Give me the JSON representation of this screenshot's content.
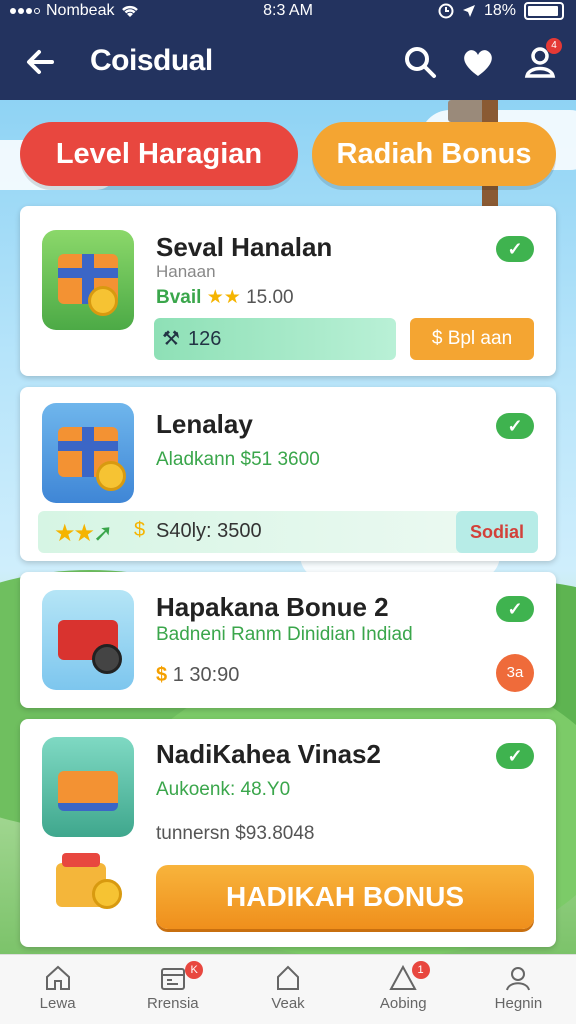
{
  "status_bar": {
    "carrier": "Nombeak",
    "time": "8:3 AM",
    "battery": "18%"
  },
  "header": {
    "title": "Coisdual",
    "notification_badge": "4"
  },
  "tabs": {
    "left": "Level Haragian",
    "right": "Radiah Bonus"
  },
  "cards": [
    {
      "title": "Seval Hanalan",
      "subtitle": "Hanaan",
      "rating_label": "Bvail",
      "rating_value": "15.00",
      "progress_value": "126",
      "action_label": "$ Bpl aan"
    },
    {
      "title": "Lenalay",
      "subtitle": "Aladkann $51 3600",
      "strip_text": "S40ly: 3500",
      "action_label": "Sodial"
    },
    {
      "title": "Hapakana Bonue 2",
      "subtitle": "Badneni Ranm Dinidian Indiad",
      "amount": "1 30:90",
      "badge": "3a"
    },
    {
      "title": "NadiKahea Vinas2",
      "subtitle": "Aukoenk: 48.Y0",
      "price_line": "tunnersn $93.8048",
      "cta_label": "HADIKAH BONUS"
    }
  ],
  "bottom_nav": [
    {
      "label": "Lewa",
      "icon": "home-icon",
      "badge": ""
    },
    {
      "label": "Rrensia",
      "icon": "calendar-icon",
      "badge": "K"
    },
    {
      "label": "Veak",
      "icon": "house-icon",
      "badge": ""
    },
    {
      "label": "Aobing",
      "icon": "warning-icon",
      "badge": "1"
    },
    {
      "label": "Hegnin",
      "icon": "profile-icon",
      "badge": ""
    }
  ],
  "colors": {
    "header_bg": "#23335f",
    "red_pill": "#e8473f",
    "orange_pill": "#f4a532",
    "check_green": "#3fb34f"
  }
}
